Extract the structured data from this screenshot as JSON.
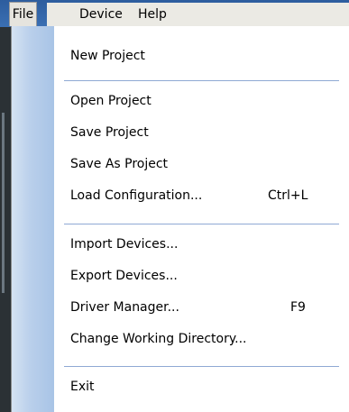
{
  "menubar": {
    "items": [
      {
        "label": "File"
      },
      {
        "label": "Device"
      },
      {
        "label": "Help"
      }
    ]
  },
  "file_menu": {
    "items": [
      {
        "label": "New Project",
        "shortcut": ""
      },
      {
        "label": "Open Project",
        "shortcut": ""
      },
      {
        "label": "Save Project",
        "shortcut": ""
      },
      {
        "label": "Save As Project",
        "shortcut": ""
      },
      {
        "label": "Load Configuration...",
        "shortcut": "Ctrl+L"
      },
      {
        "label": "Import Devices...",
        "shortcut": ""
      },
      {
        "label": "Export Devices...",
        "shortcut": ""
      },
      {
        "label": "Driver Manager...",
        "shortcut": "F9"
      },
      {
        "label": "Change Working Directory...",
        "shortcut": ""
      },
      {
        "label": "Exit",
        "shortcut": ""
      }
    ]
  }
}
